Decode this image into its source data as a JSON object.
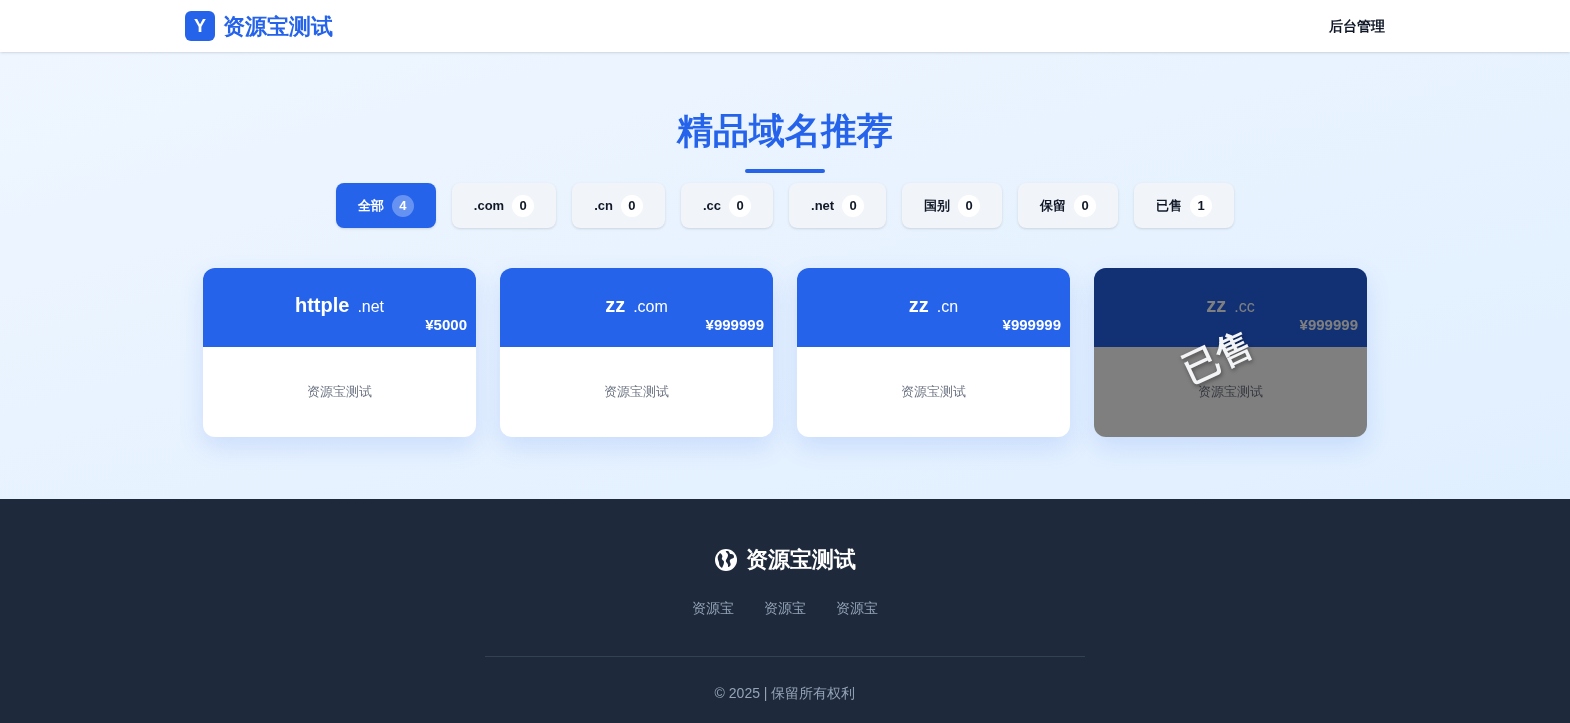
{
  "header": {
    "logo_letter": "Y",
    "site_name": "资源宝测试",
    "nav_link": "后台管理"
  },
  "hero": {
    "title": "精品域名推荐"
  },
  "filters": [
    {
      "label": "全部",
      "count": "4",
      "selected": true
    },
    {
      "label": ".com",
      "count": "0",
      "selected": false
    },
    {
      "label": ".cn",
      "count": "0",
      "selected": false
    },
    {
      "label": ".cc",
      "count": "0",
      "selected": false
    },
    {
      "label": ".net",
      "count": "0",
      "selected": false
    },
    {
      "label": "国别",
      "count": "0",
      "selected": false
    },
    {
      "label": "保留",
      "count": "0",
      "selected": false
    },
    {
      "label": "已售",
      "count": "1",
      "selected": false
    }
  ],
  "cards": [
    {
      "name": "httple",
      "suffix": ".net",
      "price": "¥5000",
      "description": "资源宝测试",
      "sold": false
    },
    {
      "name": "zz",
      "suffix": ".com",
      "price": "¥999999",
      "description": "资源宝测试",
      "sold": false
    },
    {
      "name": "zz",
      "suffix": ".cn",
      "price": "¥999999",
      "description": "资源宝测试",
      "sold": false
    },
    {
      "name": "zz",
      "suffix": ".cc",
      "price": "¥999999",
      "description": "资源宝测试",
      "sold": true,
      "stamp": "已售"
    }
  ],
  "footer": {
    "site_name": "资源宝测试",
    "links": [
      "资源宝",
      "资源宝",
      "资源宝"
    ],
    "copyright": "© 2025 | 保留所有权利"
  }
}
